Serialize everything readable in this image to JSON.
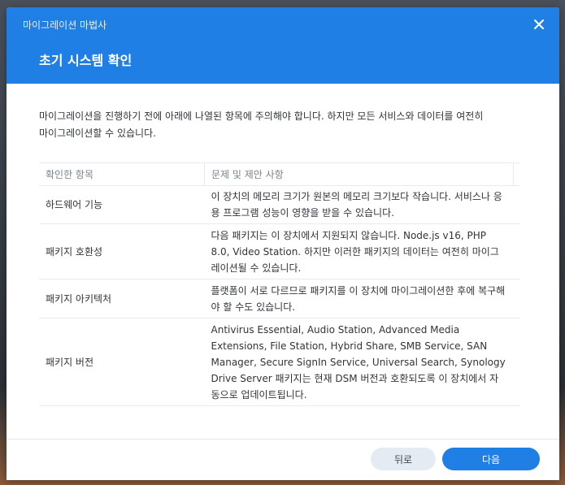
{
  "window": {
    "title": "마이그레이션 마법사",
    "close_icon": "close-icon"
  },
  "step": {
    "title": "초기 시스템 확인"
  },
  "intro": {
    "text_line1": "마이그레이션을 진행하기 전에 아래에 나열된 항목에 주의해야 합니다. 하지만 모든 서비스와 데이터를 여전히",
    "text_line2": "마이그레이션할 수 있습니다."
  },
  "table": {
    "headers": [
      "확인한 항목",
      "문제 및 제안 사항"
    ],
    "rows": [
      {
        "item": "하드웨어 기능",
        "detail": "이 장치의 메모리 크기가 원본의 메모리 크기보다 작습니다. 서비스나 응용 프로그램 성능이 영향을 받을 수 있습니다."
      },
      {
        "item": "패키지 호환성",
        "detail": "다음 패키지는 이 장치에서 지원되지 않습니다. Node.js v16, PHP 8.0, Video Station. 하지만 이러한 패키지의 데이터는 여전히 마이그레이션될 수 있습니다."
      },
      {
        "item": "패키지 아키텍처",
        "detail": "플랫폼이 서로 다르므로 패키지를 이 장치에 마이그레이션한 후에 복구해야 할 수도 있습니다."
      },
      {
        "item": "패키지 버전",
        "detail": "Antivirus Essential, Audio Station, Advanced Media Extensions, File Station, Hybrid Share, SMB Service, SAN Manager, Secure SignIn Service, Universal Search, Synology Drive Server 패키지는 현재 DSM 버전과 호환되도록 이 장치에서 자동으로 업데이트됩니다."
      }
    ]
  },
  "footer": {
    "back_label": "뒤로",
    "next_label": "다음"
  },
  "colors": {
    "accent": "#1f7fe5",
    "back_button_bg": "#e4ebf3"
  }
}
